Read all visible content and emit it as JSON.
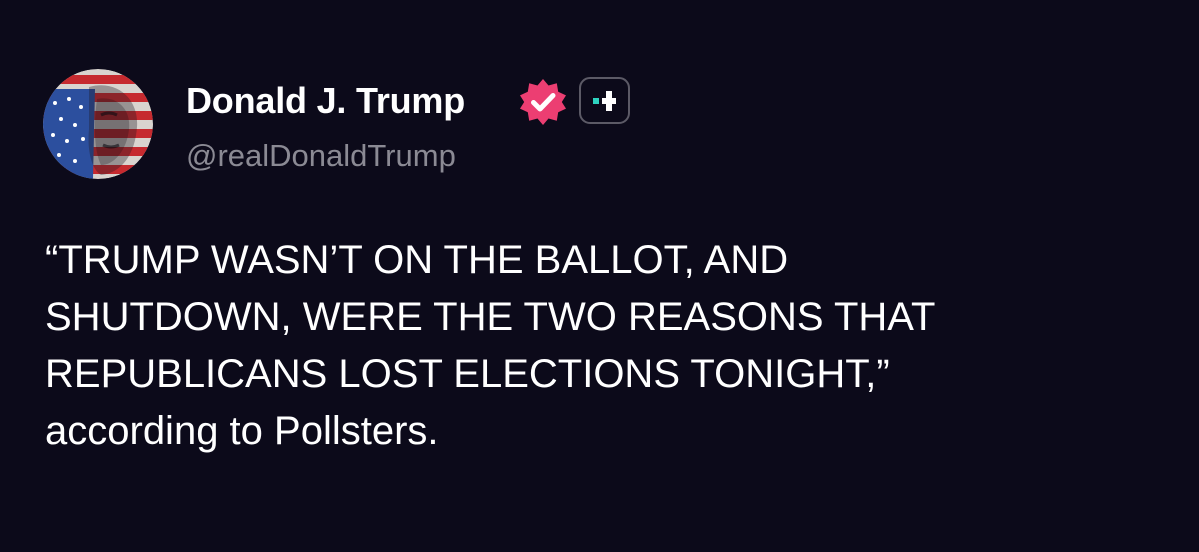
{
  "post": {
    "author": {
      "display_name": "Donald J. Trump",
      "handle": "@realDonaldTrump",
      "verified_icon": "verified-badge-icon",
      "avatar_icon": "avatar"
    },
    "follow_icon": "follow-plus-icon",
    "text_lines": [
      "“TRUMP WASN’T ON THE BALLOT, AND",
      "SHUTDOWN, WERE THE TWO REASONS THAT",
      "REPUBLICANS LOST ELECTIONS TONIGHT,”",
      "according to Pollsters."
    ]
  },
  "colors": {
    "background": "#0c0a1a",
    "text": "#ffffff",
    "handle": "#8b8a94",
    "verified": "#ec3e72",
    "follow_accent": "#2ed3c0"
  }
}
